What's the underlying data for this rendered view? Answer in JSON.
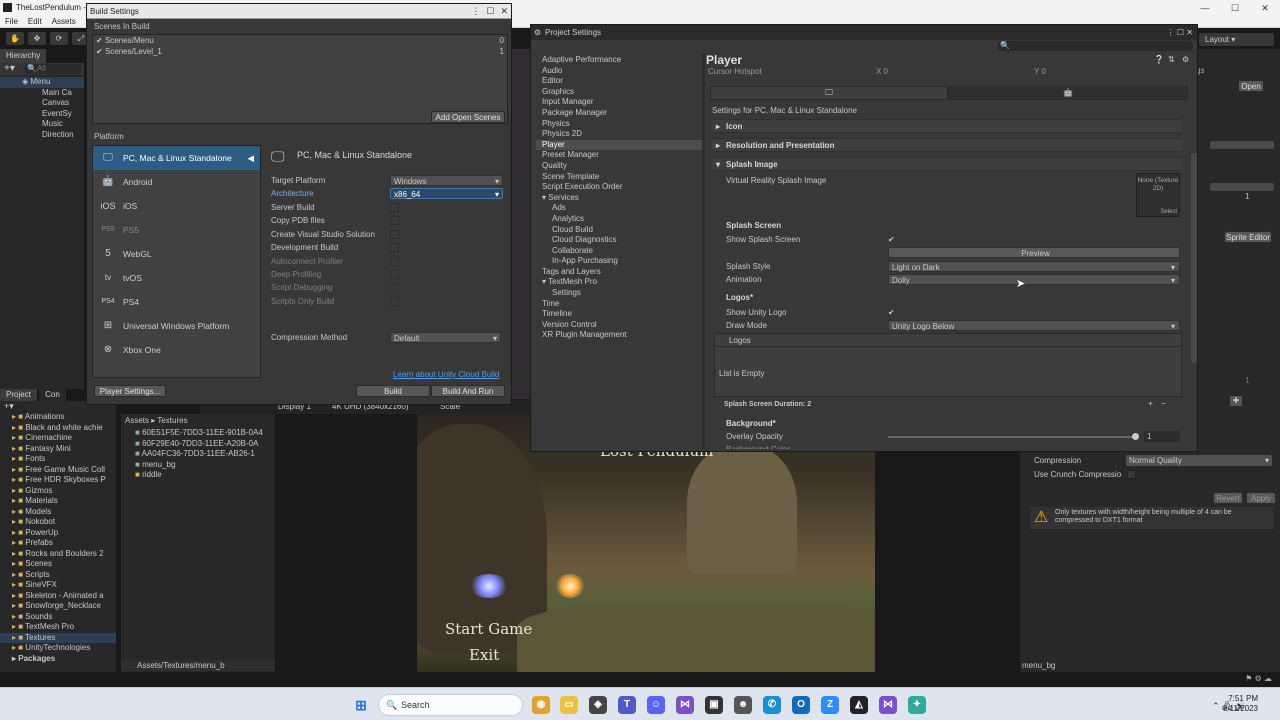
{
  "window": {
    "title": "TheLostPendulum -",
    "minimize": "—",
    "maximize": "☐",
    "close": "✕"
  },
  "menubar": [
    "File",
    "Edit",
    "Assets",
    "G"
  ],
  "layout_label": "Layout",
  "hierarchy": {
    "tab": "Hierarchy",
    "search_placeholder": "All",
    "items": [
      {
        "label": "Menu",
        "indent": 0
      },
      {
        "label": "Main Ca",
        "indent": 1
      },
      {
        "label": "Canvas",
        "indent": 1
      },
      {
        "label": "EventSy",
        "indent": 1
      },
      {
        "label": "Music",
        "indent": 1
      },
      {
        "label": "Direction",
        "indent": 1
      }
    ]
  },
  "build_settings": {
    "title": "Build Settings",
    "scenes_in_build_label": "Scenes In Build",
    "scenes": [
      {
        "name": "Scenes/Menu",
        "index": "0"
      },
      {
        "name": "Scenes/Level_1",
        "index": "1"
      }
    ],
    "add_open_scenes": "Add Open Scenes",
    "platform_label": "Platform",
    "platforms": [
      {
        "label": "PC, Mac & Linux Standalone",
        "icon": "🖵"
      },
      {
        "label": "Android",
        "icon": "🤖"
      },
      {
        "label": "iOS",
        "icon": "iOS"
      },
      {
        "label": "PS5",
        "icon": "PS5"
      },
      {
        "label": "WebGL",
        "icon": "5"
      },
      {
        "label": "tvOS",
        "icon": "tv"
      },
      {
        "label": "PS4",
        "icon": "PS4"
      },
      {
        "label": "Universal Windows Platform",
        "icon": "⊞"
      },
      {
        "label": "Xbox One",
        "icon": "⊗"
      }
    ],
    "selected_platform_title": "PC, Mac & Linux Standalone",
    "options": {
      "target_platform": {
        "label": "Target Platform",
        "value": "Windows"
      },
      "architecture": {
        "label": "Architecture",
        "value": "x86_64"
      },
      "server_build": "Server Build",
      "copy_pdb": "Copy PDB files",
      "create_vs": "Create Visual Studio Solution",
      "development_build": "Development Build",
      "autoconnect_profiler": "Autoconnect Profiler",
      "deep_profiling": "Deep Profiling",
      "script_debugging": "Script Debugging",
      "scripts_only_build": "Scripts Only Build",
      "compression": {
        "label": "Compression Method",
        "value": "Default"
      }
    },
    "cloud_link": "Learn about Unity Cloud Build",
    "player_settings_button": "Player Settings...",
    "build_button": "Build",
    "build_and_run_button": "Build And Run"
  },
  "project_settings": {
    "title": "Project Settings",
    "nav": [
      {
        "label": "Adaptive Performance",
        "sub": false
      },
      {
        "label": "Audio",
        "sub": false
      },
      {
        "label": "Editor",
        "sub": false
      },
      {
        "label": "Graphics",
        "sub": false
      },
      {
        "label": "Input Manager",
        "sub": false
      },
      {
        "label": "Package Manager",
        "sub": false
      },
      {
        "label": "Physics",
        "sub": false
      },
      {
        "label": "Physics 2D",
        "sub": false
      },
      {
        "label": "Player",
        "sub": false,
        "selected": true
      },
      {
        "label": "Preset Manager",
        "sub": false
      },
      {
        "label": "Quality",
        "sub": false
      },
      {
        "label": "Scene Template",
        "sub": false
      },
      {
        "label": "Script Execution Order",
        "sub": false
      },
      {
        "label": "▾ Services",
        "sub": false
      },
      {
        "label": "Ads",
        "sub": true
      },
      {
        "label": "Analytics",
        "sub": true
      },
      {
        "label": "Cloud Build",
        "sub": true
      },
      {
        "label": "Cloud Diagnostics",
        "sub": true
      },
      {
        "label": "Collaborate",
        "sub": true
      },
      {
        "label": "In-App Purchasing",
        "sub": true
      },
      {
        "label": "Tags and Layers",
        "sub": false
      },
      {
        "label": "▾ TextMesh Pro",
        "sub": false
      },
      {
        "label": "Settings",
        "sub": true
      },
      {
        "label": "Time",
        "sub": false
      },
      {
        "label": "Timeline",
        "sub": false
      },
      {
        "label": "Version Control",
        "sub": false
      },
      {
        "label": "XR Plugin Management",
        "sub": false
      }
    ],
    "player": {
      "heading": "Player",
      "cursor_hotspot": "Cursor Hotspot",
      "hotspot_x": "X 0",
      "hotspot_y": "Y 0",
      "settings_for": "Settings for PC, Mac & Linux Standalone",
      "icon_section": "Icon",
      "resolution_section": "Resolution and Presentation",
      "splash_section": "Splash Image",
      "vr_splash": "Virtual Reality Splash Image",
      "texture_none": "None (Texture 2D)",
      "texture_select": "Select",
      "splash_screen_heading": "Splash Screen",
      "show_splash": "Show Splash Screen",
      "preview_button": "Preview",
      "splash_style": {
        "label": "Splash Style",
        "value": "Light on Dark"
      },
      "animation": {
        "label": "Animation",
        "value": "Dolly"
      },
      "logos_heading": "Logos*",
      "show_unity_logo": "Show Unity Logo",
      "draw_mode": {
        "label": "Draw Mode",
        "value": "Unity Logo Below"
      },
      "logos_list": "Logos",
      "list_empty": "List is Empty",
      "duration": "Splash Screen Duration: 2",
      "background_heading": "Background*",
      "overlay_opacity": {
        "label": "Overlay Opacity",
        "value": "1",
        "fraction": 1.0
      },
      "background_color": "Background Color"
    }
  },
  "project_panel": {
    "tabs": [
      "Project",
      "Con"
    ],
    "folders": [
      "Animations",
      "Black and white achie",
      "Cinemachine",
      "Fantasy Mini",
      "Fonts",
      "Free Game Music Coll",
      "Free HDR Skyboxes P",
      "Gizmos",
      "Materials",
      "Models",
      "Nokobot",
      "PowerUp",
      "Prefabs",
      "Rocks and Boulders 2",
      "Scenes",
      "Scripts",
      "SineVFX",
      "Skeleton - Animated a",
      "Snowforge_Necklace",
      "Sounds",
      "TextMesh Pro",
      "Textures",
      "UnityTechnologies"
    ],
    "packages": "Packages",
    "breadcrumb": [
      "Assets",
      "Textures"
    ],
    "files": [
      "60E51F5E-7DD3-11EE-901B-0A4",
      "60F29E40-7DD3-11EE-A20B-0A",
      "AA04FC36-7DD3-11EE-AB26-1",
      "menu_bg",
      "riddle"
    ],
    "path": "Assets/Textures/menu_b"
  },
  "game_view": {
    "display": "Display 1",
    "resolution": "4K UHD (3840x2160)",
    "scale": "Scale",
    "title_partial": "Lost Pendulum",
    "start_game": "Start Game",
    "exit": "Exit"
  },
  "inspector": {
    "open_button": "Open",
    "sprite_editor": "Sprite Editor",
    "ws_fragment": "gs",
    "compression": {
      "label": "Compression",
      "value": "Normal Quality"
    },
    "use_crunch": "Use Crunch Compressio",
    "revert": "Revert",
    "apply": "Apply",
    "warning": "Only textures with width/height being multiple of 4 can be compressed to DXT1 format",
    "footer": "menu_bg",
    "value_1": "1",
    "value_1b": "1"
  },
  "taskbar": {
    "search": "Search",
    "time": "7:51 PM",
    "date": "8/11/2023"
  },
  "colors": {
    "accent": "#2c5d87",
    "link": "#4a9ee8",
    "warning": "#f0c000"
  }
}
